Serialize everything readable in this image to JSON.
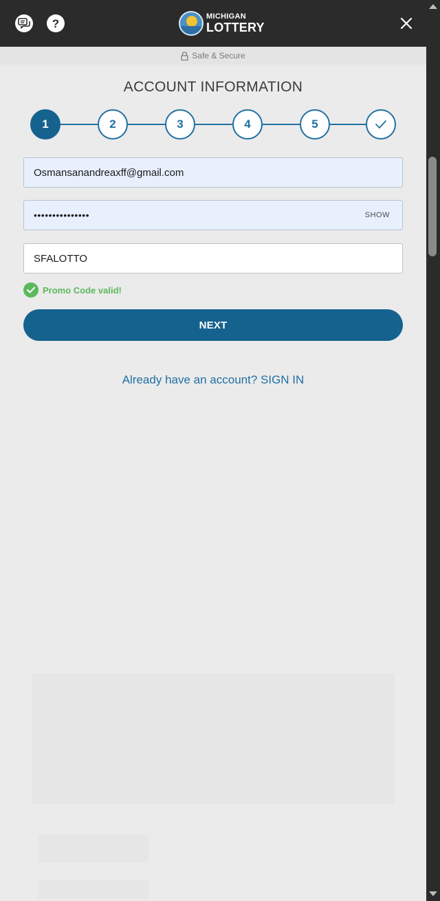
{
  "header": {
    "chat_icon": "chat-icon",
    "help_icon": "question-mark-icon",
    "help_glyph": "?",
    "logo": {
      "line1": "MICHIGAN",
      "line2": "LOTTERY"
    },
    "close_icon": "close-icon"
  },
  "secure_bar": {
    "label": "Safe & Secure",
    "icon": "lock-icon"
  },
  "title": "ACCOUNT INFORMATION",
  "steps": [
    {
      "label": "1",
      "active": true
    },
    {
      "label": "2",
      "active": false
    },
    {
      "label": "3",
      "active": false
    },
    {
      "label": "4",
      "active": false
    },
    {
      "label": "5",
      "active": false
    },
    {
      "label": "",
      "icon": "checkmark-icon",
      "active": false
    }
  ],
  "form": {
    "email": "Osmansanandreaxff@gmail.com",
    "password_masked": "•••••••••••••••",
    "show_label": "SHOW",
    "promo_code": "SFALOTTO",
    "promo_valid_msg": "Promo Code valid!"
  },
  "next_button": "NEXT",
  "signin_link": "Already have an account? SIGN IN",
  "colors": {
    "primary": "#16628f",
    "accent_blue": "#1f6fa3",
    "success": "#5cb85c",
    "header_bg": "#2b2b2b"
  }
}
